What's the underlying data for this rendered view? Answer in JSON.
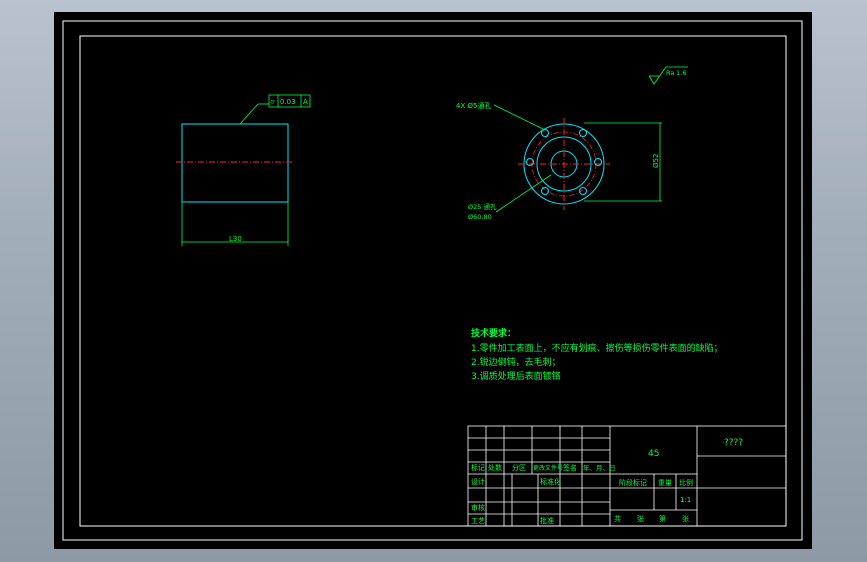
{
  "gdt": {
    "symbol": "⌭",
    "tolerance": "0.03",
    "datum": "A"
  },
  "roughness": {
    "value": "1.6",
    "prefix": "Ra"
  },
  "dims": {
    "length": "L30",
    "height": "Ø52",
    "holes": "4X Ø5通孔",
    "bore_top": "Ø25 通孔",
    "bore_bottom": "Ø60.80"
  },
  "tech": {
    "title": "技术要求：",
    "items": [
      "1.零件加工表面上，不应有划痕、擦伤等损伤零件表面的缺陷；",
      "2.锐边倒钝，去毛刺；",
      "3.调质处理后表面镀铬"
    ]
  },
  "titleblock": {
    "material": "45",
    "name": "????",
    "headers": [
      "标记",
      "处数",
      "分区",
      "更改文件号",
      "签名",
      "年、月、日"
    ],
    "rows": [
      "设计",
      "审核",
      "工艺"
    ],
    "std": "标准化",
    "approve": "批准",
    "stage": "阶段标记",
    "weight": "重量",
    "ratio_label": "比例",
    "ratio": "1:1",
    "sheets": [
      "共",
      "张",
      "第",
      "张"
    ]
  }
}
